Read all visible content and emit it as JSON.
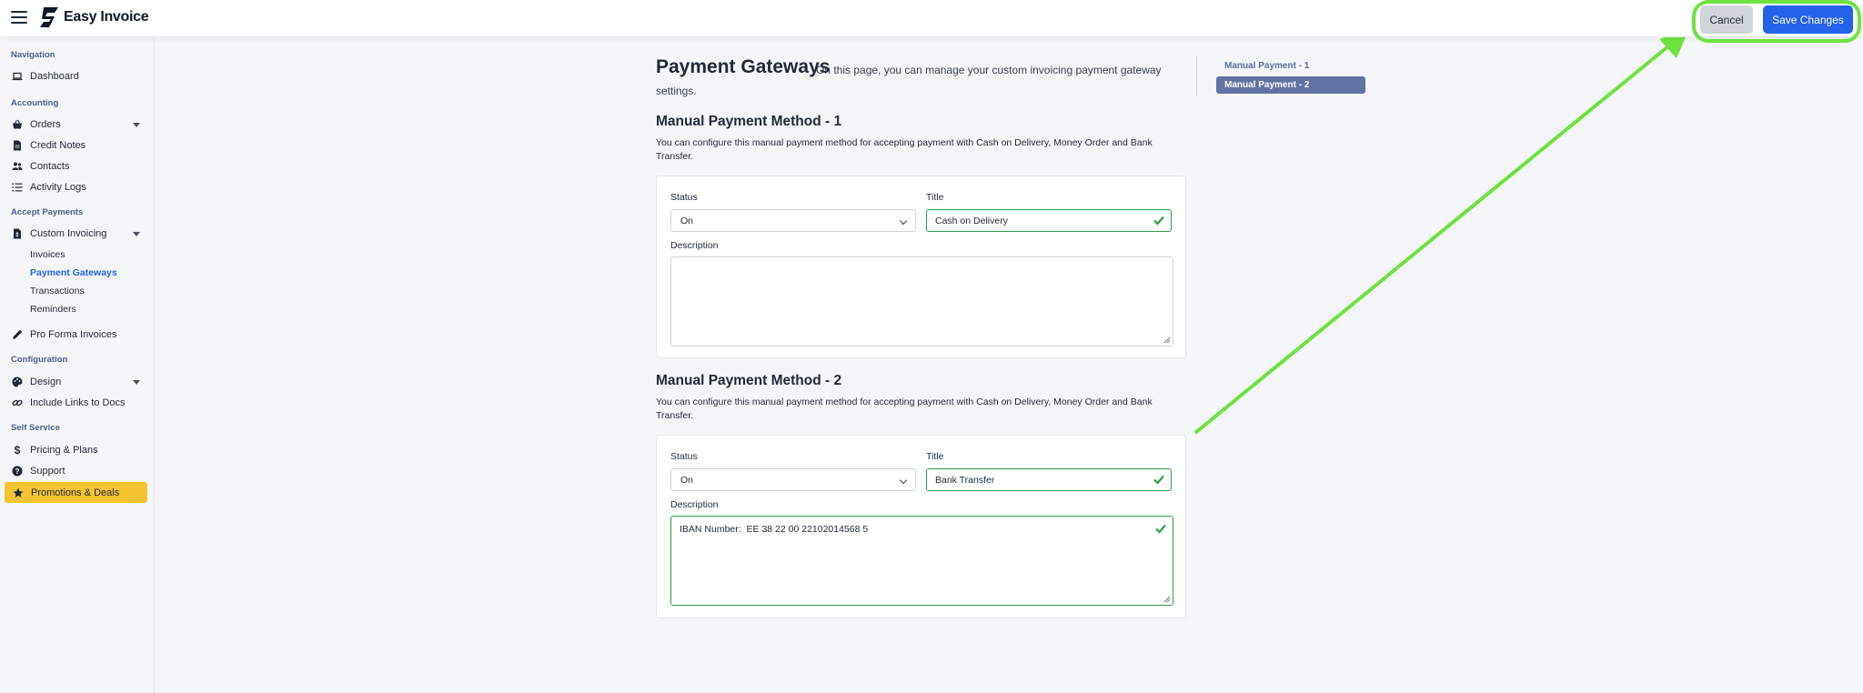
{
  "app": {
    "name": "Easy Invoice"
  },
  "toolbar": {
    "cancel_label": "Cancel",
    "save_label": "Save Changes"
  },
  "sidebar": {
    "sections": [
      {
        "label": "Navigation"
      },
      {
        "label": "Accounting"
      },
      {
        "label": "Accept Payments"
      },
      {
        "label": "Configuration"
      },
      {
        "label": "Self Service"
      }
    ],
    "items": [
      {
        "label": "Dashboard",
        "icon": "laptop-icon"
      },
      {
        "label": "Orders",
        "icon": "basket-icon"
      },
      {
        "label": "Credit Notes",
        "icon": "document-icon"
      },
      {
        "label": "Contacts",
        "icon": "users-icon"
      },
      {
        "label": "Activity Logs",
        "icon": "list-icon"
      },
      {
        "label": "Custom Invoicing",
        "icon": "invoice-icon"
      },
      {
        "label": "Pro Forma Invoices",
        "icon": "pen-icon"
      },
      {
        "label": "Design",
        "icon": "palette-icon"
      },
      {
        "label": "Include Links to Docs",
        "icon": "link-icon"
      },
      {
        "label": "Pricing & Plans",
        "icon": "dollar-icon"
      },
      {
        "label": "Support",
        "icon": "question-icon"
      },
      {
        "label": "Promotions & Deals",
        "icon": "star-icon"
      }
    ],
    "custom_invoicing_sub": [
      {
        "label": "Invoices"
      },
      {
        "label": "Payment Gateways"
      },
      {
        "label": "Transactions"
      },
      {
        "label": "Reminders"
      }
    ]
  },
  "page": {
    "title": "Payment Gateways",
    "description": "On this page, you can manage your custom invoicing payment gateway settings."
  },
  "right_nav": [
    {
      "label": "Manual Payment - 1"
    },
    {
      "label": "Manual Payment - 2"
    }
  ],
  "methods": [
    {
      "heading": "Manual Payment Method - 1",
      "description": "You can configure this manual payment method for accepting payment with Cash on Delivery, Money Order and Bank Transfer.",
      "status_label": "Status",
      "status_value": "On",
      "title_label": "Title",
      "title_value": "Cash on Delivery",
      "description_label": "Description",
      "description_value": ""
    },
    {
      "heading": "Manual Payment Method - 2",
      "description": "You can configure this manual payment method for accepting payment with Cash on Delivery, Money Order and Bank Transfer.",
      "status_label": "Status",
      "status_value": "On",
      "title_label": "Title",
      "title_value": "Bank Transfer",
      "description_label": "Description",
      "description_value": "IBAN Number:  EE 38 22 00 22102014568 5"
    }
  ],
  "colors": {
    "primary": "#2563eb",
    "valid": "#2f9e44",
    "highlight": "#6ee33f",
    "promo": "#f4c430"
  }
}
